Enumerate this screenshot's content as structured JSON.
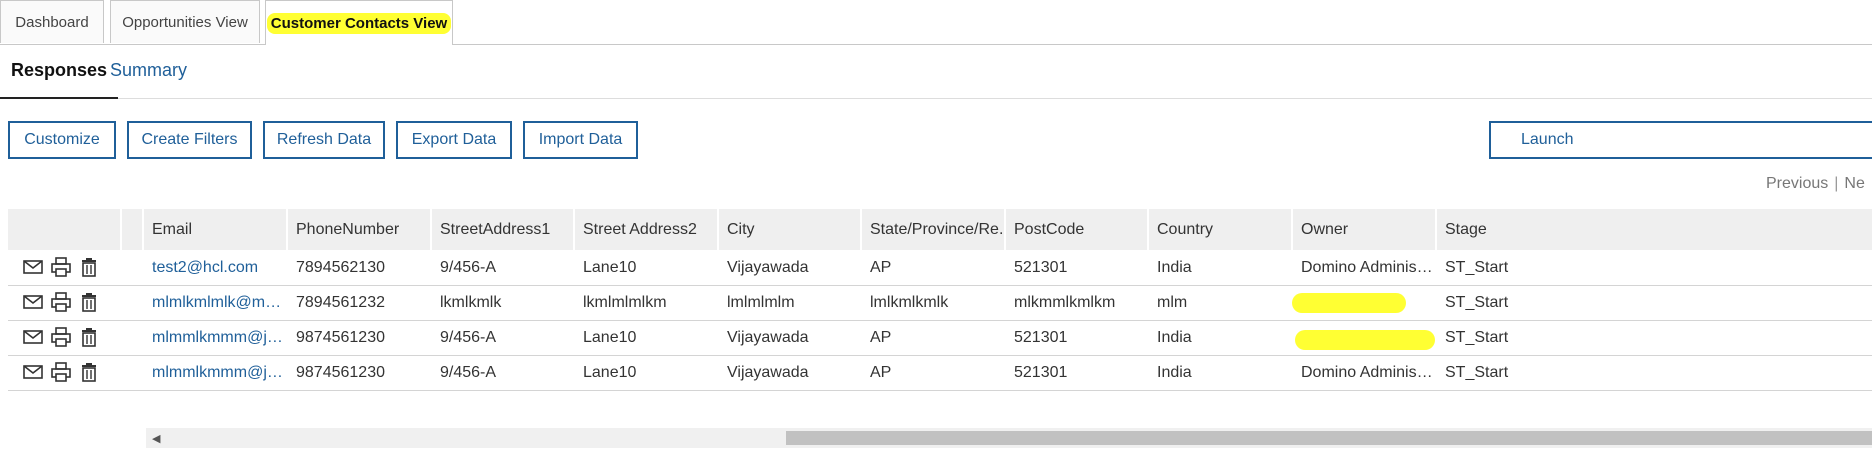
{
  "top_tabs": [
    {
      "label": "Dashboard"
    },
    {
      "label": "Opportunities View"
    },
    {
      "label": "Customer Contacts View"
    }
  ],
  "sub_tabs": [
    {
      "label": "Responses"
    },
    {
      "label": "Summary"
    }
  ],
  "toolbar": {
    "customize": "Customize",
    "create_filters": "Create Filters",
    "refresh_data": "Refresh Data",
    "export_data": "Export Data",
    "import_data": "Import Data",
    "launch": "Launch"
  },
  "pager": {
    "previous": "Previous",
    "separator": "|",
    "next": "Ne"
  },
  "table": {
    "columns": [
      "Email",
      "PhoneNumber",
      "StreetAddress1",
      "Street Address2",
      "City",
      "State/Province/Re...",
      "PostCode",
      "Country",
      "Owner",
      "Stage"
    ],
    "rows": [
      [
        "test2@hcl.com",
        "7894562130",
        "9/456-A",
        "Lane10",
        "Vijayawada",
        "AP",
        "521301",
        "India",
        "Domino Administr...",
        "ST_Start"
      ],
      [
        "mlmlkmlmlk@mlk....",
        "7894561232",
        "lkmlkmlk",
        "lkmlmlmlkm",
        "lmlmlmlm",
        "lmlkmlkmlk",
        "mlkmmlkmlkm",
        "mlm",
        "",
        "ST_Start"
      ],
      [
        "mlmmlkmmm@jk...",
        "9874561230",
        "9/456-A",
        "Lane10",
        "Vijayawada",
        "AP",
        "521301",
        "India",
        "",
        "ST_Start"
      ],
      [
        "mlmmlkmmm@jk...",
        "9874561230",
        "9/456-A",
        "Lane10",
        "Vijayawada",
        "AP",
        "521301",
        "India",
        "Domino Administr...",
        "ST_Start"
      ]
    ]
  },
  "colors": {
    "accent": "#1f5f99",
    "highlight": "#ffff33",
    "header_bg": "#efefef"
  },
  "icons": [
    "mail-icon",
    "print-icon",
    "trash-icon"
  ]
}
